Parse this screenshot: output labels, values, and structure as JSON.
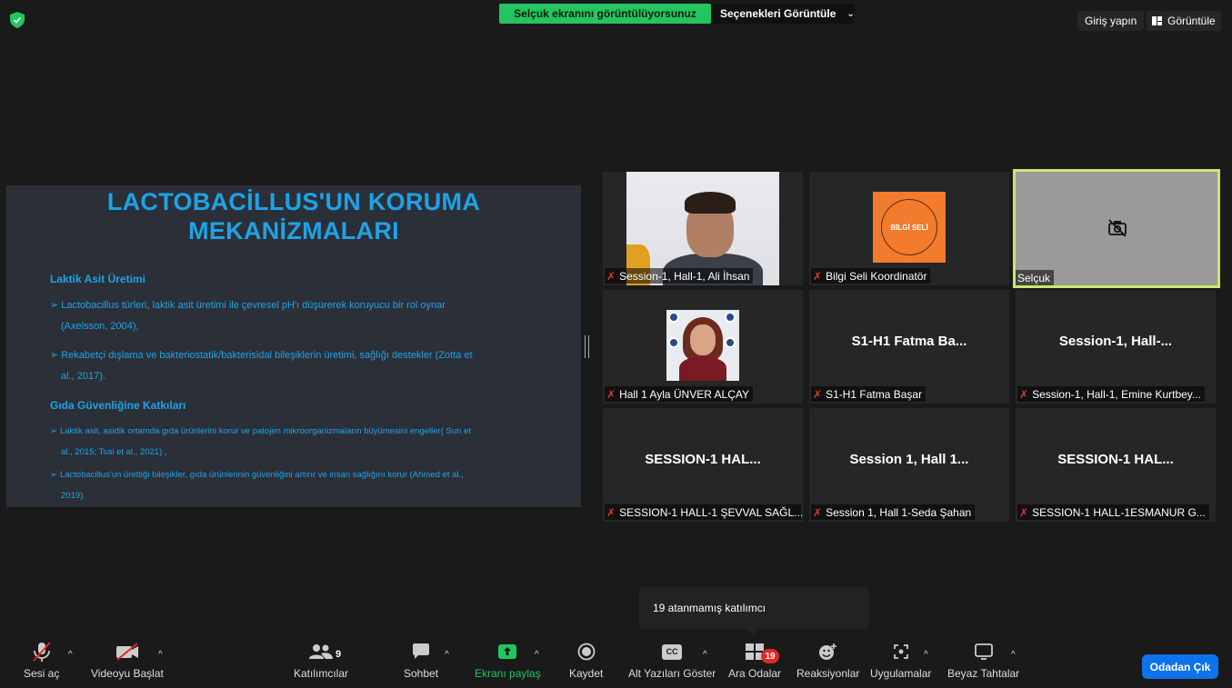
{
  "top_bar": {
    "share_status": "Selçuk ekranını görüntülüyorsunuz",
    "view_options": "Seçenekleri Görüntüle",
    "sign_in": "Giriş yapın",
    "view": "Görüntüle"
  },
  "slide": {
    "title_line1": "LACTOBACİLLUS'UN KORUMA",
    "title_line2": "MEKANİZMALARI",
    "section1_heading": "Laktik Asit Üretimi",
    "s1_p1_line1": "Lactobacillus türleri, laktik asit üretimi ile çevresel pH'ı düşürerek koruyucu bir rol oynar",
    "s1_p1_line2": "(Axelsson, 2004),",
    "s1_p2_line1": "Rekabetçi dışlama ve bakteriostatik/bakterisidal bileşiklerin üretimi, sağlığı destekler (Zotta et",
    "s1_p2_line2": "al., 2017).",
    "section2_heading": "Gıda Güvenliğine Katkıları",
    "s2_p1_line1": "Laktik asit, asidik ortamda gıda ürünlerini korur ve patojen mikroorganizmaların büyümesini engeller( Sun et",
    "s2_p1_line2": "al., 2015; Tsai et al., 2021) ,",
    "s2_p2_line1": "Lactobacillus'un ürettiği bileşikler, gıda ürünlerinin güvenliğini artırır ve insan sağlığını korur (Ahmed et al.,",
    "s2_p2_line2": "2019)."
  },
  "participants": [
    {
      "name": "Session-1, Hall-1, Ali İhsan",
      "big": "",
      "muted": true
    },
    {
      "name": "Bilgi Seli Koordinatör",
      "big": "",
      "muted": true
    },
    {
      "name": "Selçuk",
      "big": "",
      "muted": false
    },
    {
      "name": "Hall 1 Ayla ÜNVER ALÇAY",
      "big": "",
      "muted": true
    },
    {
      "name": "S1-H1 Fatma Başar",
      "big": "S1-H1 Fatma Ba...",
      "muted": true
    },
    {
      "name": "Session-1, Hall-1, Emine Kurtbey...",
      "big": "Session-1,  Hall-...",
      "muted": true
    },
    {
      "name": "SESSION-1 HALL-1 ŞEVVAL SAĞL...",
      "big": "SESSION-1  HAL...",
      "muted": true
    },
    {
      "name": "Session 1, Hall 1-Seda Şahan",
      "big": "Session 1, Hall 1...",
      "muted": true
    },
    {
      "name": "SESSION-1 HALL-1ESMANUR G...",
      "big": "SESSION-1  HAL...",
      "muted": true
    }
  ],
  "logo_text": "BİLGİ SELİ",
  "tooltip": "19 atanmamış katılımcı",
  "toolbar": {
    "unmute": "Sesi aç",
    "start_video": "Videoyu Başlat",
    "participants": "Katılımcılar",
    "participants_count": "9",
    "chat": "Sohbet",
    "share_screen": "Ekranı paylaş",
    "record": "Kaydet",
    "captions": "Alt Yazıları Göster",
    "cc": "CC",
    "breakout": "Ara Odalar",
    "breakout_count": "19",
    "reactions": "Reaksiyonlar",
    "apps": "Uygulamalar",
    "whiteboards": "Beyaz Tahtalar",
    "leave": "Odadan Çık"
  },
  "colors": {
    "share_green": "#23c55e",
    "slide_text": "#1fa2e6",
    "active_border": "#c8e86e",
    "leave_blue": "#0e72ed",
    "muted_red": "#e0362c"
  }
}
